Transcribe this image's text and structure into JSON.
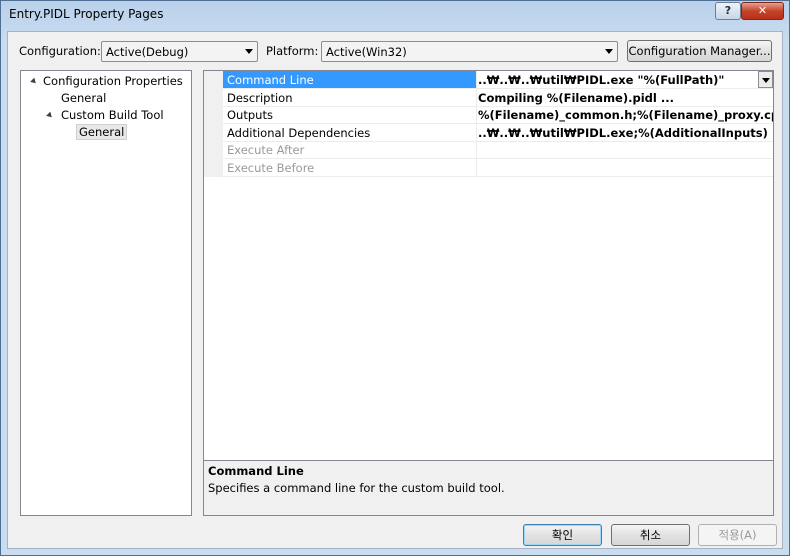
{
  "window": {
    "title": "Entry.PIDL Property Pages",
    "help_glyph": "?",
    "close_glyph": "✕"
  },
  "top": {
    "configuration_label": "Configuration:",
    "configuration_value": "Active(Debug)",
    "platform_label": "Platform:",
    "platform_value": "Active(Win32)",
    "config_manager_label": "Configuration Manager..."
  },
  "tree": {
    "root": "Configuration Properties",
    "general": "General",
    "custom_build_tool": "Custom Build Tool",
    "cbt_general": "General"
  },
  "grid": {
    "rows": [
      {
        "name": "Command Line",
        "value": "..₩..₩..₩util₩PIDL.exe \"%(FullPath)\""
      },
      {
        "name": "Description",
        "value": "Compiling %(Filename).pidl ..."
      },
      {
        "name": "Outputs",
        "value": "%(Filename)_common.h;%(Filename)_proxy.cpp;%(Filena"
      },
      {
        "name": "Additional Dependencies",
        "value": "..₩..₩..₩util₩PIDL.exe;%(AdditionalInputs)"
      },
      {
        "name": "Execute After",
        "value": ""
      },
      {
        "name": "Execute Before",
        "value": ""
      }
    ]
  },
  "description": {
    "title": "Command Line",
    "text": "Specifies a command line for the custom build tool."
  },
  "buttons": {
    "ok": "확인",
    "cancel": "취소",
    "apply": "적용(A)"
  }
}
